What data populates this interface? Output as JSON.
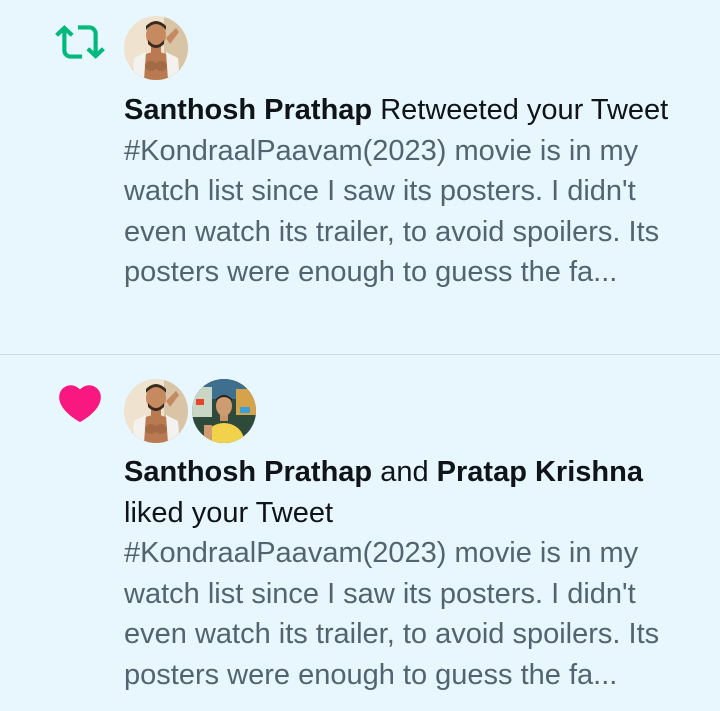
{
  "notifications": [
    {
      "type": "retweet",
      "type_icon": "retweet-icon",
      "actor1": "Santhosh Prathap",
      "connector": "",
      "actor2": "",
      "action": " Retweeted your Tweet",
      "tweet_text": "#KondraalPaavam(2023) movie is in my watch list since I saw its posters. I didn't even watch its trailer, to avoid spoilers. Its posters were enough to guess the fa..."
    },
    {
      "type": "like",
      "type_icon": "heart-icon",
      "actor1": "Santhosh Prathap",
      "connector": " and ",
      "actor2": "Pratap Krishna",
      "action": " liked your Tweet",
      "tweet_text": "#KondraalPaavam(2023) movie is in my watch list since I saw its posters. I didn't even watch its trailer, to avoid spoilers. Its posters were enough to guess the fa..."
    }
  ],
  "colors": {
    "background": "#e8f6fd",
    "retweet_green": "#00ba7c",
    "like_pink": "#f91880",
    "primary_text": "#0f1419",
    "secondary_text": "#536471",
    "divider": "#cfd9de"
  }
}
